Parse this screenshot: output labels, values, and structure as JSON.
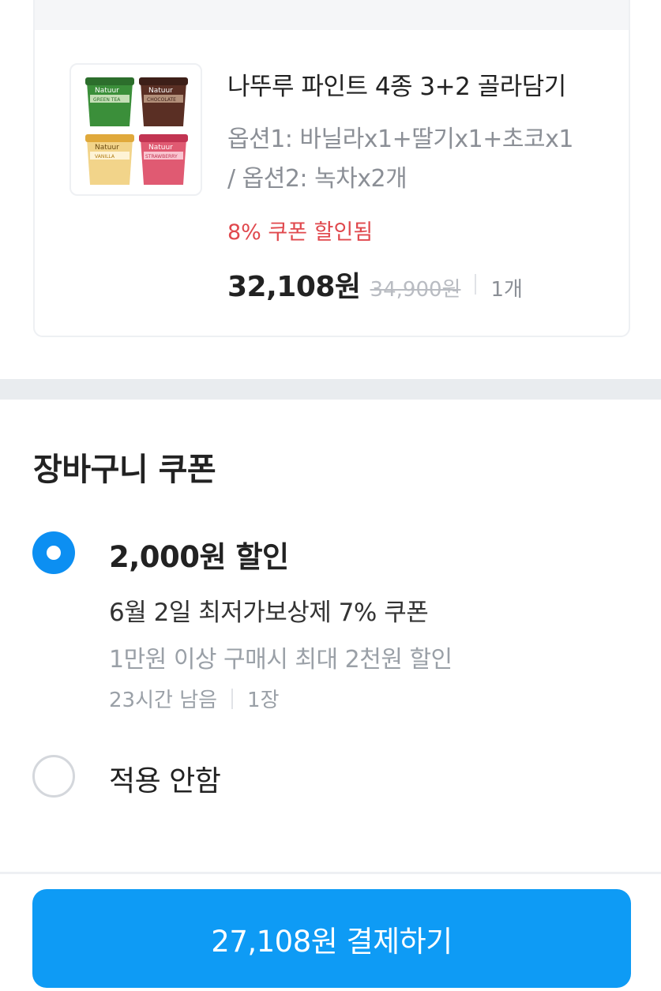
{
  "product": {
    "name": "나뚜루 파인트 4종 3+2 골라담기",
    "option_line1": "옵션1: 바닐라x1+딸기x1+초코x1",
    "option_line2": "/ 옵션2: 녹차x2개",
    "coupon_applied": "8% 쿠폰 할인됨",
    "price": "32,108원",
    "original_price": "34,900원",
    "quantity": "1개",
    "image_brand": "Natuur",
    "image_flavors": [
      "GREEN TEA",
      "CHOCOLATE",
      "VANILLA",
      "STRAWBERRY"
    ]
  },
  "cart_coupon": {
    "title": "장바구니 쿠폰",
    "options": [
      {
        "amount": "2,000원 할인",
        "name": "6월 2일 최저가보상제 7% 쿠폰",
        "condition": "1만원 이상 구매시 최대 2천원 할인",
        "time_left": "23시간 남음",
        "count": "1장",
        "selected": true
      },
      {
        "label": "적용 안함",
        "selected": false
      }
    ]
  },
  "pay_button": {
    "label": "27,108원 결제하기"
  },
  "colors": {
    "accent": "#0e9bf5",
    "radio_selected": "#0c8ff2",
    "discount_red": "#e0484d",
    "muted_text": "#9aa0a7",
    "section_gap": "#e9ecef"
  }
}
